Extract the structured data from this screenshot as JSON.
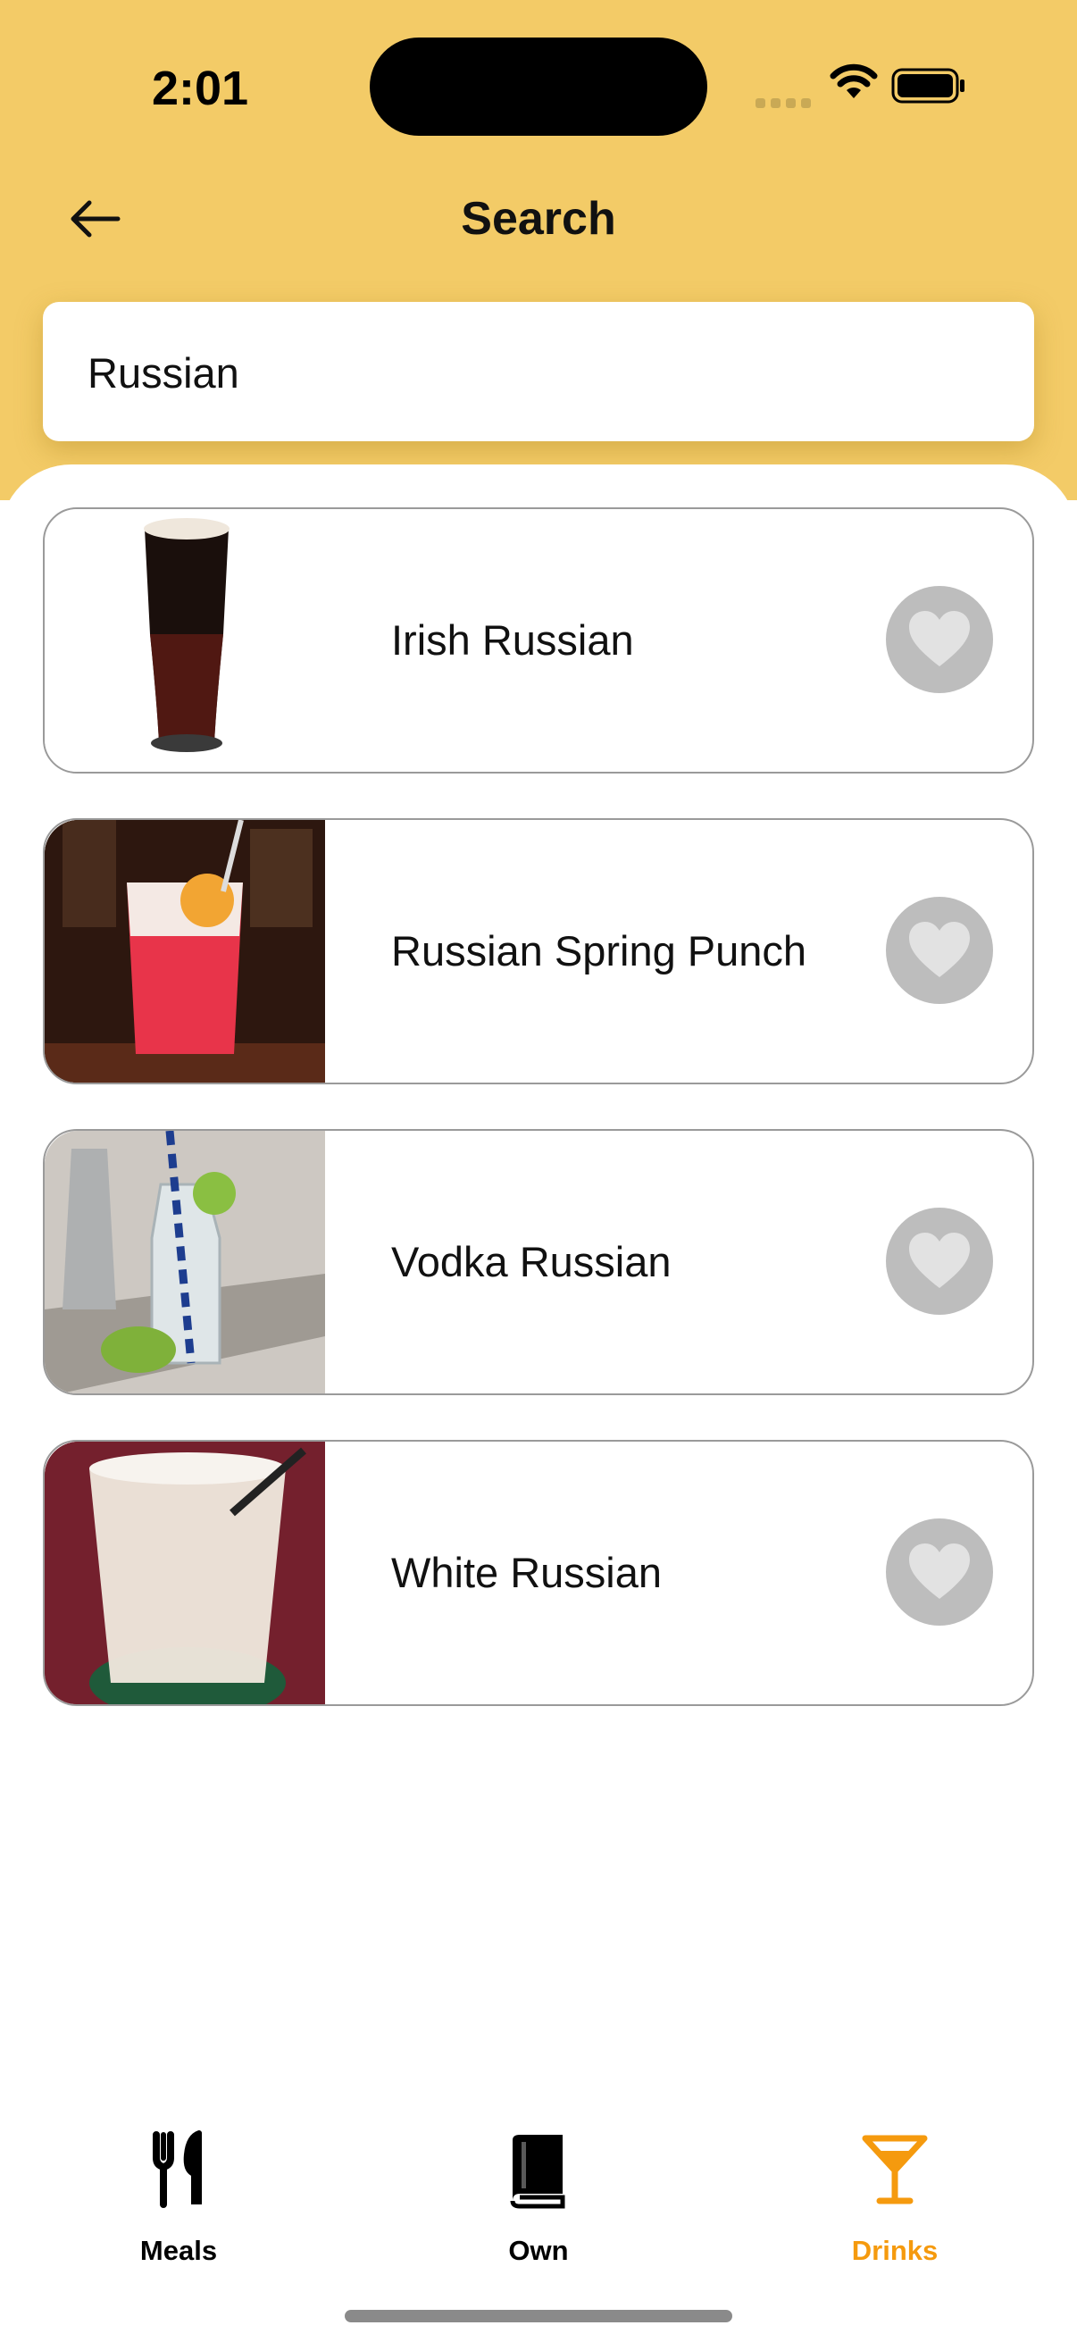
{
  "status_bar": {
    "time": "2:01"
  },
  "header": {
    "title": "Search"
  },
  "search": {
    "value": "Russian"
  },
  "results": [
    {
      "name": "Irish Russian"
    },
    {
      "name": "Russian Spring Punch"
    },
    {
      "name": "Vodka Russian"
    },
    {
      "name": "White Russian"
    }
  ],
  "tabbar": {
    "tabs": [
      {
        "label": "Meals",
        "icon": "fork-knife-icon"
      },
      {
        "label": "Own",
        "icon": "book-icon"
      },
      {
        "label": "Drinks",
        "icon": "cocktail-icon",
        "active": true
      }
    ],
    "active_color": "#F59A0E"
  },
  "colors": {
    "header_bg": "#F3CB67",
    "fav_bg": "#BDBDBD"
  }
}
